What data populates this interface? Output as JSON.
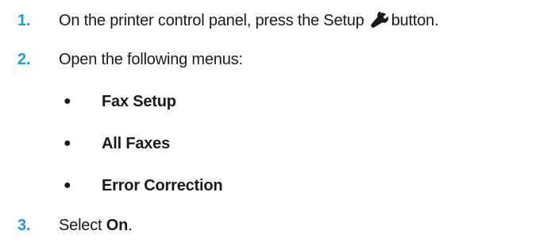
{
  "steps": [
    {
      "number": "1.",
      "text_before": "On the printer control panel, press the Setup",
      "icon": "wrench-icon",
      "text_after": "button."
    },
    {
      "number": "2.",
      "text": "Open the following menus:",
      "menus": [
        "Fax Setup",
        "All Faxes",
        "Error Correction"
      ]
    },
    {
      "number": "3.",
      "text_before": "Select",
      "bold": "On",
      "text_after": "."
    }
  ],
  "bullet_glyph": "●",
  "colors": {
    "step_number": "#1a9ad6",
    "text": "#1a1a1a"
  }
}
